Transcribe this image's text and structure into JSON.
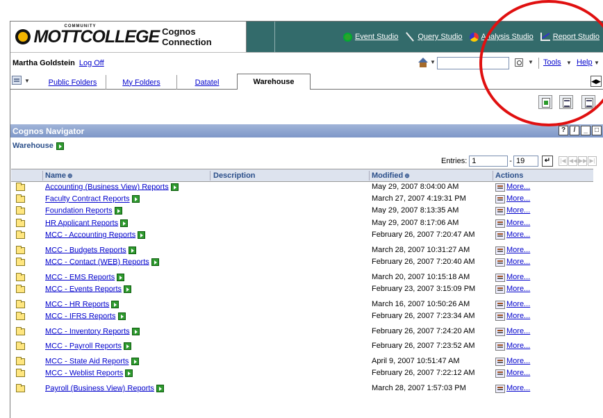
{
  "banner": {
    "logo_word": "MOTTCOLLEGE",
    "logo_small": "COMMUNITY",
    "app_name": "Cognos Connection",
    "studios": [
      {
        "label": "Event Studio",
        "icon": "event-studio-icon"
      },
      {
        "label": "Query Studio",
        "icon": "query-studio-icon"
      },
      {
        "label": "Analysis Studio",
        "icon": "analysis-studio-icon"
      },
      {
        "label": "Report Studio",
        "icon": "report-studio-icon"
      }
    ]
  },
  "userbar": {
    "user_name": "Martha Goldstein",
    "logoff": "Log Off",
    "search_value": "",
    "tools": "Tools",
    "help": "Help"
  },
  "tabs": {
    "items": [
      "Public Folders",
      "My Folders",
      "Datatel"
    ],
    "active": "Warehouse"
  },
  "navigator": {
    "title": "Cognos Navigator",
    "breadcrumb": "Warehouse",
    "entries_label": "Entries:",
    "entries_from": "1",
    "entries_to": "19"
  },
  "table": {
    "headers": {
      "name": "Name",
      "description": "Description",
      "modified": "Modified",
      "actions": "Actions"
    },
    "rows": [
      {
        "name": "Accounting (Business View) Reports",
        "modified": "May 29, 2007 8:04:00 AM",
        "action": "More..."
      },
      {
        "name": "Faculty Contract Reports",
        "modified": "March 27, 2007 4:19:31 PM",
        "action": "More..."
      },
      {
        "name": "Foundation Reports",
        "modified": "May 29, 2007 8:13:35 AM",
        "action": "More..."
      },
      {
        "name": "HR Applicant Reports",
        "modified": "May 29, 2007 8:17:06 AM",
        "action": "More..."
      },
      {
        "name": "MCC - Accounting Reports",
        "modified": "February 26, 2007 7:20:47 AM",
        "action": "More..."
      },
      {
        "name": "MCC - Budgets Reports",
        "modified": "March 28, 2007 10:31:27 AM",
        "action": "More..."
      },
      {
        "name": "MCC - Contact (WEB) Reports",
        "modified": "February 26, 2007 7:20:40 AM",
        "action": "More..."
      },
      {
        "name": "MCC - EMS Reports",
        "modified": "March 20, 2007 10:15:18 AM",
        "action": "More..."
      },
      {
        "name": "MCC - Events Reports",
        "modified": "February 23, 2007 3:15:09 PM",
        "action": "More..."
      },
      {
        "name": "MCC - HR Reports",
        "modified": "March 16, 2007 10:50:26 AM",
        "action": "More..."
      },
      {
        "name": "MCC - IFRS Reports",
        "modified": "February 26, 2007 7:23:34 AM",
        "action": "More..."
      },
      {
        "name": "MCC - Inventory Reports",
        "modified": "February 26, 2007 7:24:20 AM",
        "action": "More..."
      },
      {
        "name": "MCC - Payroll Reports",
        "modified": "February 26, 2007 7:23:52 AM",
        "action": "More..."
      },
      {
        "name": "MCC - State Aid Reports",
        "modified": "April 9, 2007 10:51:47 AM",
        "action": "More..."
      },
      {
        "name": "MCC - Weblist Reports",
        "modified": "February 26, 2007 7:22:12 AM",
        "action": "More..."
      },
      {
        "name": "Payroll (Business View) Reports",
        "modified": "March 28, 2007 1:57:03 PM",
        "action": "More..."
      }
    ]
  },
  "colors": {
    "banner": "#336b6b",
    "navigator_header": "#8fa5d0",
    "annotation": "#e01010"
  }
}
